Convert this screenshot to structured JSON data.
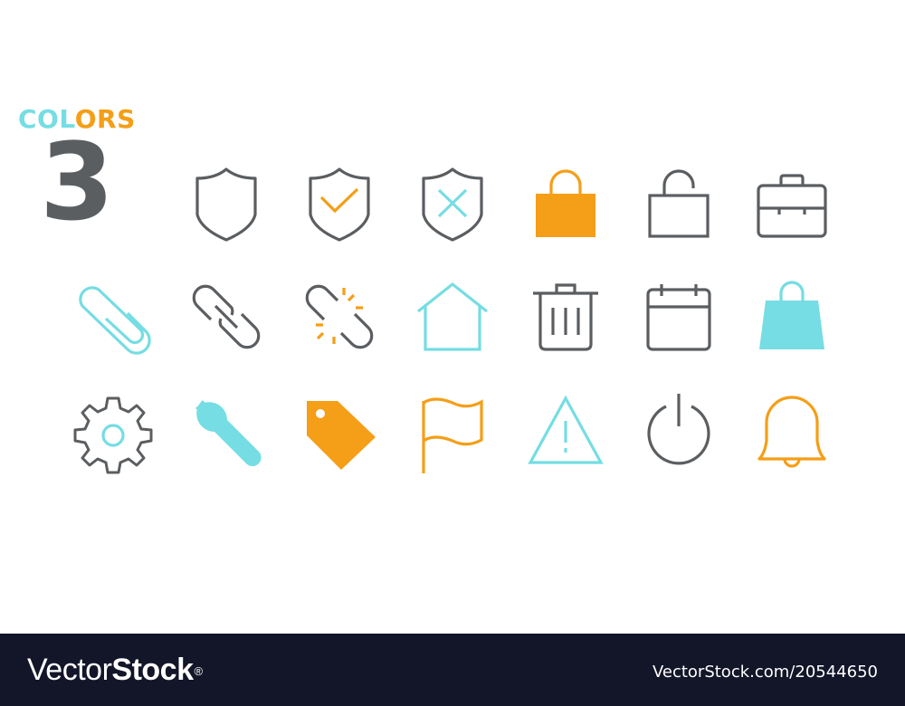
{
  "header": {
    "title_part1": "COL",
    "title_part2": "ORS",
    "count": "3"
  },
  "palette": {
    "gray": "#5b5e61",
    "cyan": "#75dde3",
    "orange": "#f59e17",
    "footer_bg": "#131529"
  },
  "icons": [
    {
      "row": 1,
      "name": "shield-icon",
      "color": "gray",
      "style": "outline"
    },
    {
      "row": 1,
      "name": "shield-check-icon",
      "color": "gray+orange",
      "style": "outline"
    },
    {
      "row": 1,
      "name": "shield-x-icon",
      "color": "gray+cyan",
      "style": "outline"
    },
    {
      "row": 1,
      "name": "lock-closed-icon",
      "color": "orange",
      "style": "filled"
    },
    {
      "row": 1,
      "name": "lock-open-icon",
      "color": "gray",
      "style": "outline"
    },
    {
      "row": 1,
      "name": "briefcase-icon",
      "color": "gray",
      "style": "outline"
    },
    {
      "row": 2,
      "name": "paperclip-icon",
      "color": "cyan",
      "style": "outline"
    },
    {
      "row": 2,
      "name": "link-icon",
      "color": "gray",
      "style": "outline"
    },
    {
      "row": 2,
      "name": "broken-link-icon",
      "color": "gray+orange",
      "style": "outline"
    },
    {
      "row": 2,
      "name": "home-icon",
      "color": "cyan",
      "style": "outline"
    },
    {
      "row": 2,
      "name": "trash-icon",
      "color": "gray",
      "style": "outline"
    },
    {
      "row": 2,
      "name": "calendar-icon",
      "color": "gray",
      "style": "outline"
    },
    {
      "row": 2,
      "name": "shopping-bag-icon",
      "color": "cyan",
      "style": "filled"
    },
    {
      "row": 3,
      "name": "gear-icon",
      "color": "gray+cyan",
      "style": "outline"
    },
    {
      "row": 3,
      "name": "wrench-icon",
      "color": "cyan",
      "style": "filled"
    },
    {
      "row": 3,
      "name": "tag-icon",
      "color": "orange",
      "style": "filled"
    },
    {
      "row": 3,
      "name": "flag-icon",
      "color": "orange",
      "style": "outline"
    },
    {
      "row": 3,
      "name": "warning-icon",
      "color": "cyan",
      "style": "outline"
    },
    {
      "row": 3,
      "name": "power-icon",
      "color": "gray",
      "style": "outline"
    },
    {
      "row": 3,
      "name": "bell-icon",
      "color": "orange",
      "style": "outline"
    }
  ],
  "footer": {
    "logo_light": "Vector",
    "logo_bold": "Stock",
    "logo_mark": "®",
    "reference": "VectorStock.com/20544650"
  }
}
